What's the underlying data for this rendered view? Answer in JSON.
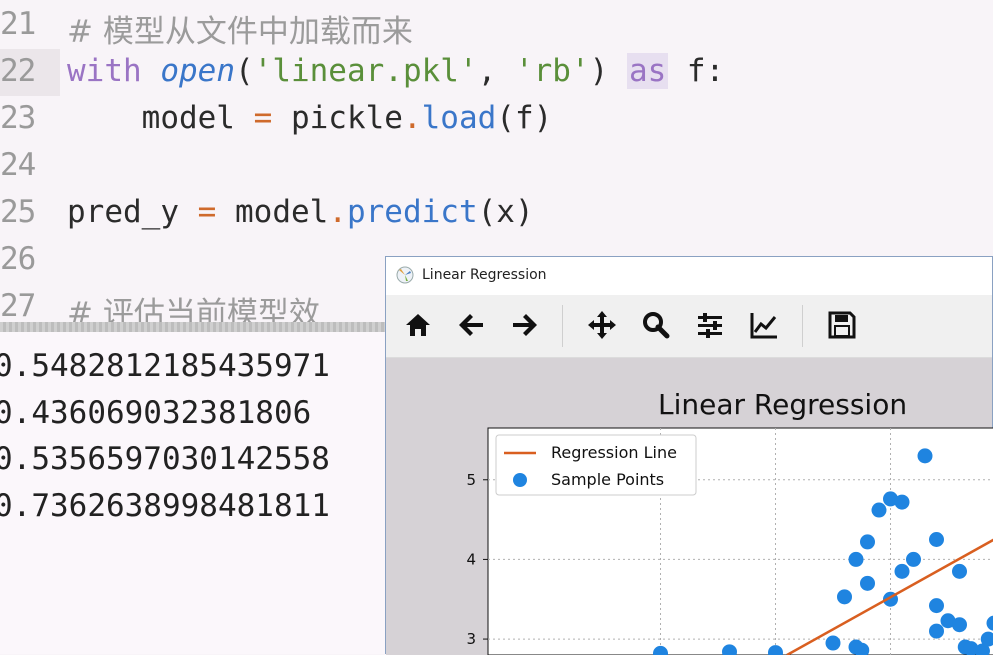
{
  "editor": {
    "lines": [
      {
        "num": "21",
        "comment": "# 模型从文件中加载而来"
      },
      {
        "num": "22",
        "kw_with": "with",
        "fn_open": "open",
        "p1": "(",
        "s1": "'linear.pkl'",
        "comma": ", ",
        "s2": "'rb'",
        "p2": ") ",
        "kw_as": "as",
        "rest": " f:"
      },
      {
        "num": "23",
        "indent": "    ",
        "model": "model ",
        "eq": "=",
        "pickle": " pickle",
        "dot": ".",
        "fn_load": "load",
        "args": "(f)"
      },
      {
        "num": "24"
      },
      {
        "num": "25",
        "pred": "pred_y ",
        "eq": "=",
        "model": " model",
        "dot": ".",
        "fn_predict": "predict",
        "args": "(x)"
      },
      {
        "num": "26"
      },
      {
        "num": "27",
        "comment": "# 评估当前模型效"
      }
    ]
  },
  "console": {
    "outputs": [
      "0.5482812185435971",
      "0.436069032381806",
      "0.5356597030142558",
      "0.7362638998481811"
    ]
  },
  "window": {
    "title": "Linear Regression",
    "toolbar": [
      {
        "name": "home-icon"
      },
      {
        "name": "back-arrow-icon"
      },
      {
        "name": "forward-arrow-icon"
      },
      {
        "name": "pan-icon"
      },
      {
        "name": "zoom-icon"
      },
      {
        "name": "subplots-icon"
      },
      {
        "name": "customize-icon"
      },
      {
        "name": "save-icon"
      }
    ]
  },
  "chart_data": {
    "type": "scatter",
    "title": "Linear Regression",
    "ylim": [
      2.8,
      5.65
    ],
    "xlim": [
      0,
      4.4
    ],
    "y_ticks": [
      "3",
      "4",
      "5"
    ],
    "grid": true,
    "legend_position": "top-left",
    "colors": {
      "line": "#d95f20",
      "points": "#1f84e0"
    },
    "series": [
      {
        "name": "Regression Line",
        "type": "line",
        "x": [
          2.6,
          4.4
        ],
        "y": [
          2.8,
          4.25
        ]
      },
      {
        "name": "Sample Points",
        "type": "scatter",
        "x": [
          3.0,
          3.1,
          3.2,
          3.2,
          3.3,
          3.3,
          3.4,
          3.5,
          3.5,
          3.6,
          3.6,
          3.7,
          3.8,
          3.9,
          3.9,
          3.9,
          4.0,
          4.1,
          4.1,
          4.15,
          4.2,
          4.3,
          4.35,
          4.4,
          1.5,
          2.1,
          2.5,
          3.25
        ],
        "y": [
          2.95,
          3.53,
          4.0,
          2.9,
          4.22,
          3.7,
          4.62,
          4.76,
          3.5,
          3.85,
          4.72,
          4.0,
          5.3,
          4.25,
          3.42,
          3.1,
          3.23,
          3.18,
          3.85,
          2.9,
          2.88,
          2.85,
          3.0,
          3.2,
          2.82,
          2.84,
          2.83,
          2.86
        ]
      }
    ]
  }
}
